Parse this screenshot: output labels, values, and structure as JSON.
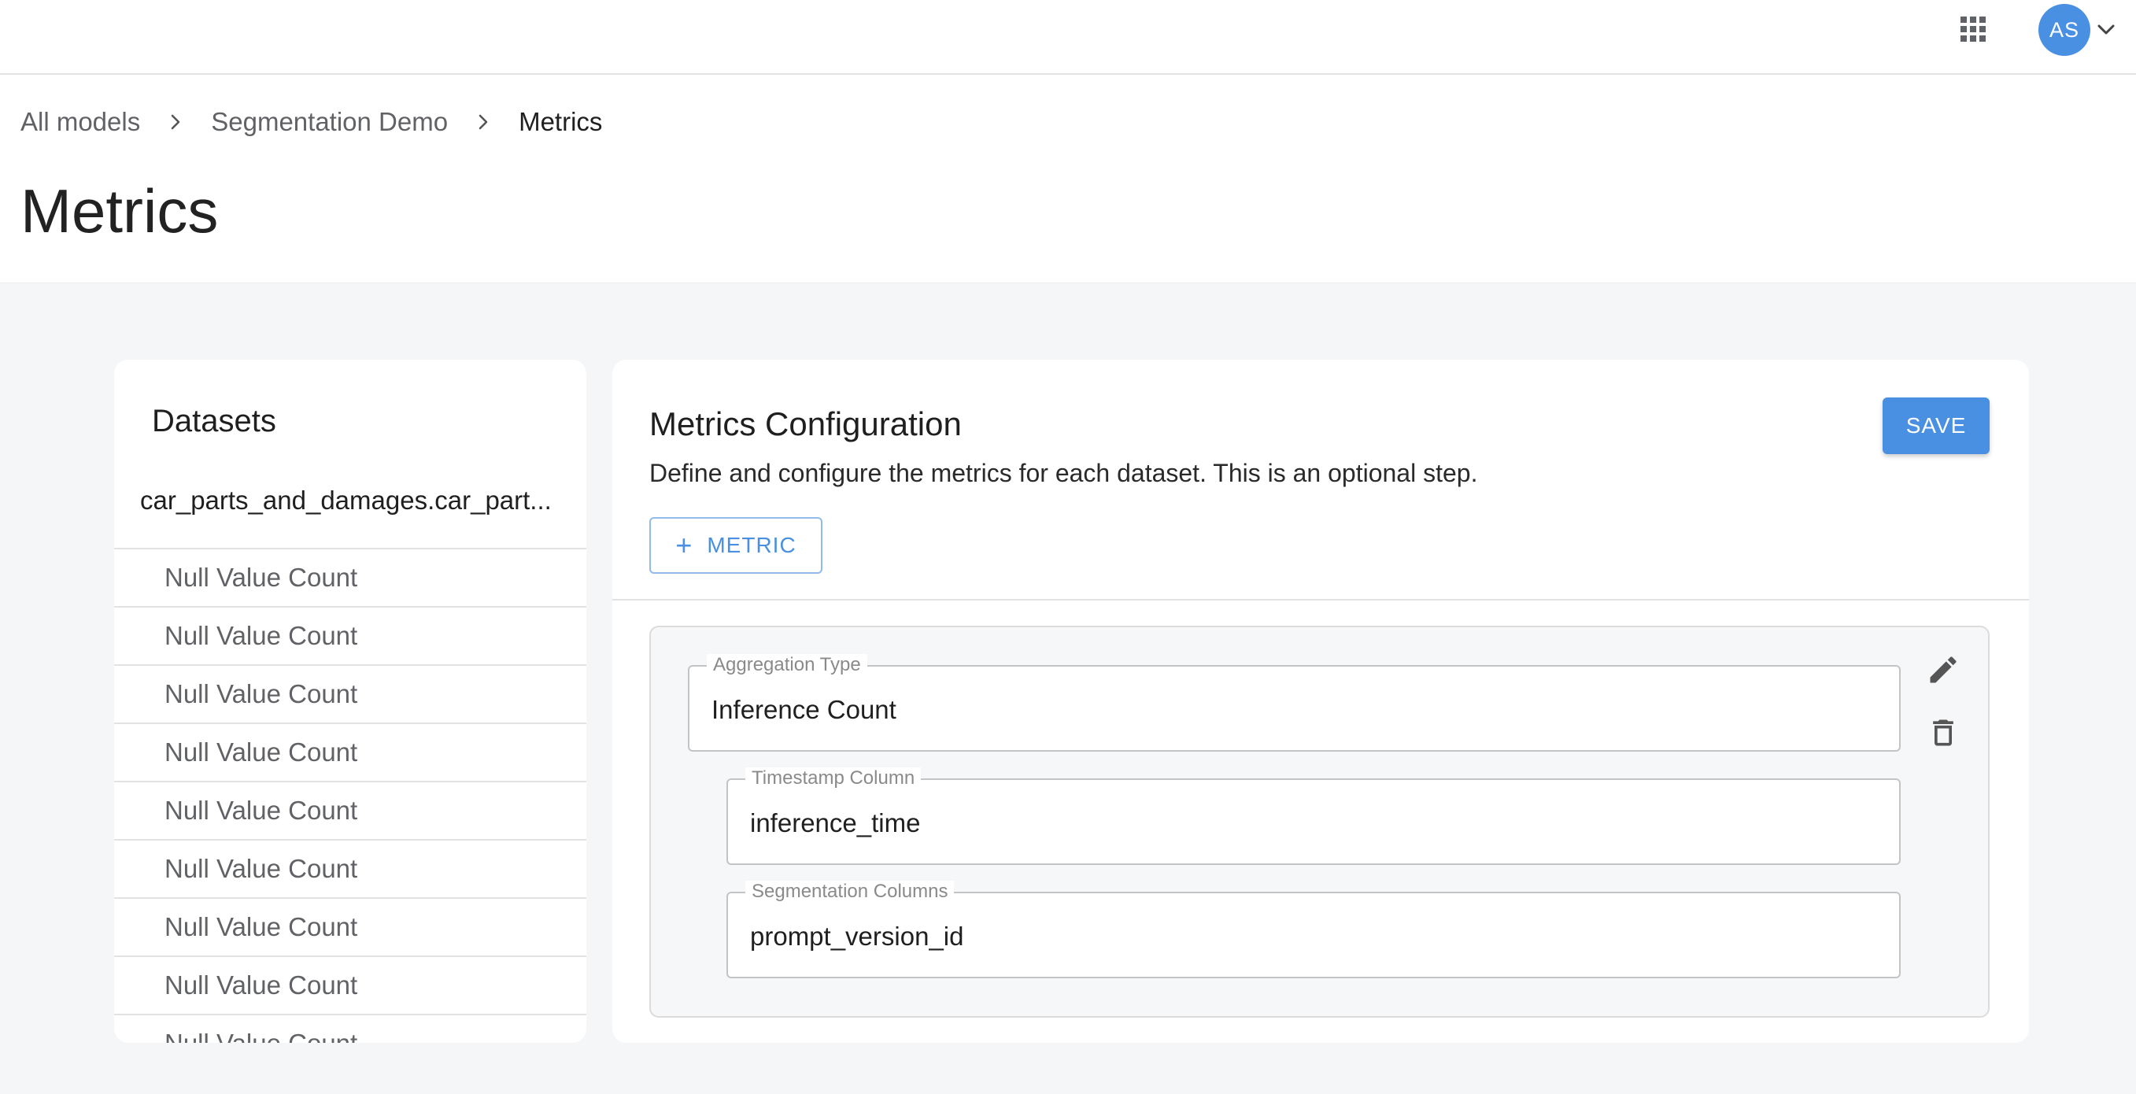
{
  "topbar": {
    "apps_icon": "grid-apps-icon",
    "avatar_initials": "AS",
    "account_menu_icon": "chevron-down-icon"
  },
  "breadcrumb": {
    "items": [
      "All models",
      "Segmentation Demo"
    ],
    "current": "Metrics",
    "separator_icon": "chevron-right-icon"
  },
  "page": {
    "title": "Metrics"
  },
  "datasets": {
    "title": "Datasets",
    "selected_dataset": "car_parts_and_damages.car_part...",
    "metrics": [
      "Null Value Count",
      "Null Value Count",
      "Null Value Count",
      "Null Value Count",
      "Null Value Count",
      "Null Value Count",
      "Null Value Count",
      "Null Value Count",
      "Null Value Count"
    ]
  },
  "config": {
    "title": "Metrics Configuration",
    "description": "Define and configure the metrics for each dataset. This is an optional step.",
    "save_label": "SAVE",
    "add_metric_label": "METRIC",
    "metric": {
      "aggregation_type": {
        "label": "Aggregation Type",
        "value": "Inference Count"
      },
      "timestamp_column": {
        "label": "Timestamp Column",
        "value": "inference_time"
      },
      "segmentation_columns": {
        "label": "Segmentation Columns",
        "value": "prompt_version_id"
      }
    }
  },
  "colors": {
    "accent": "#4a90e2",
    "background": "#f5f6f7",
    "surface": "#ffffff"
  }
}
